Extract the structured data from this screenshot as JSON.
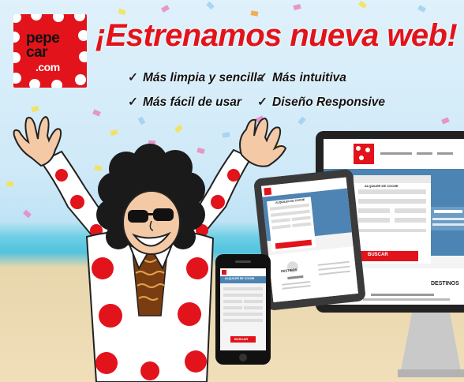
{
  "logo": {
    "lines": [
      "pepe",
      "car",
      ".com"
    ]
  },
  "headline": "¡Estrenamos nueva web!",
  "features": [
    "Más limpia y sencilla",
    "Más intuitiva",
    "Más fácil de usar",
    "Diseño Responsive"
  ],
  "icons": {
    "check": "check-icon",
    "character": "mascot-illustration",
    "devices": "responsive-devices-illustration"
  },
  "colors": {
    "brand_red": "#e2131b",
    "text_dark": "#111111",
    "sky": "#cfe9f8",
    "sea": "#52c3de",
    "sand": "#f0dfb9"
  },
  "monitor": {
    "button": "BUSCAR",
    "section_title": "DESTINOS",
    "form_title": "ALQUILER DE COCHE"
  },
  "tablet": {
    "form_title": "ALQUILER DE COCHE",
    "section_title": "DESTINOS"
  },
  "phone": {
    "form_title": "ALQUILER DE COCHE",
    "button": "BUSCAR"
  }
}
